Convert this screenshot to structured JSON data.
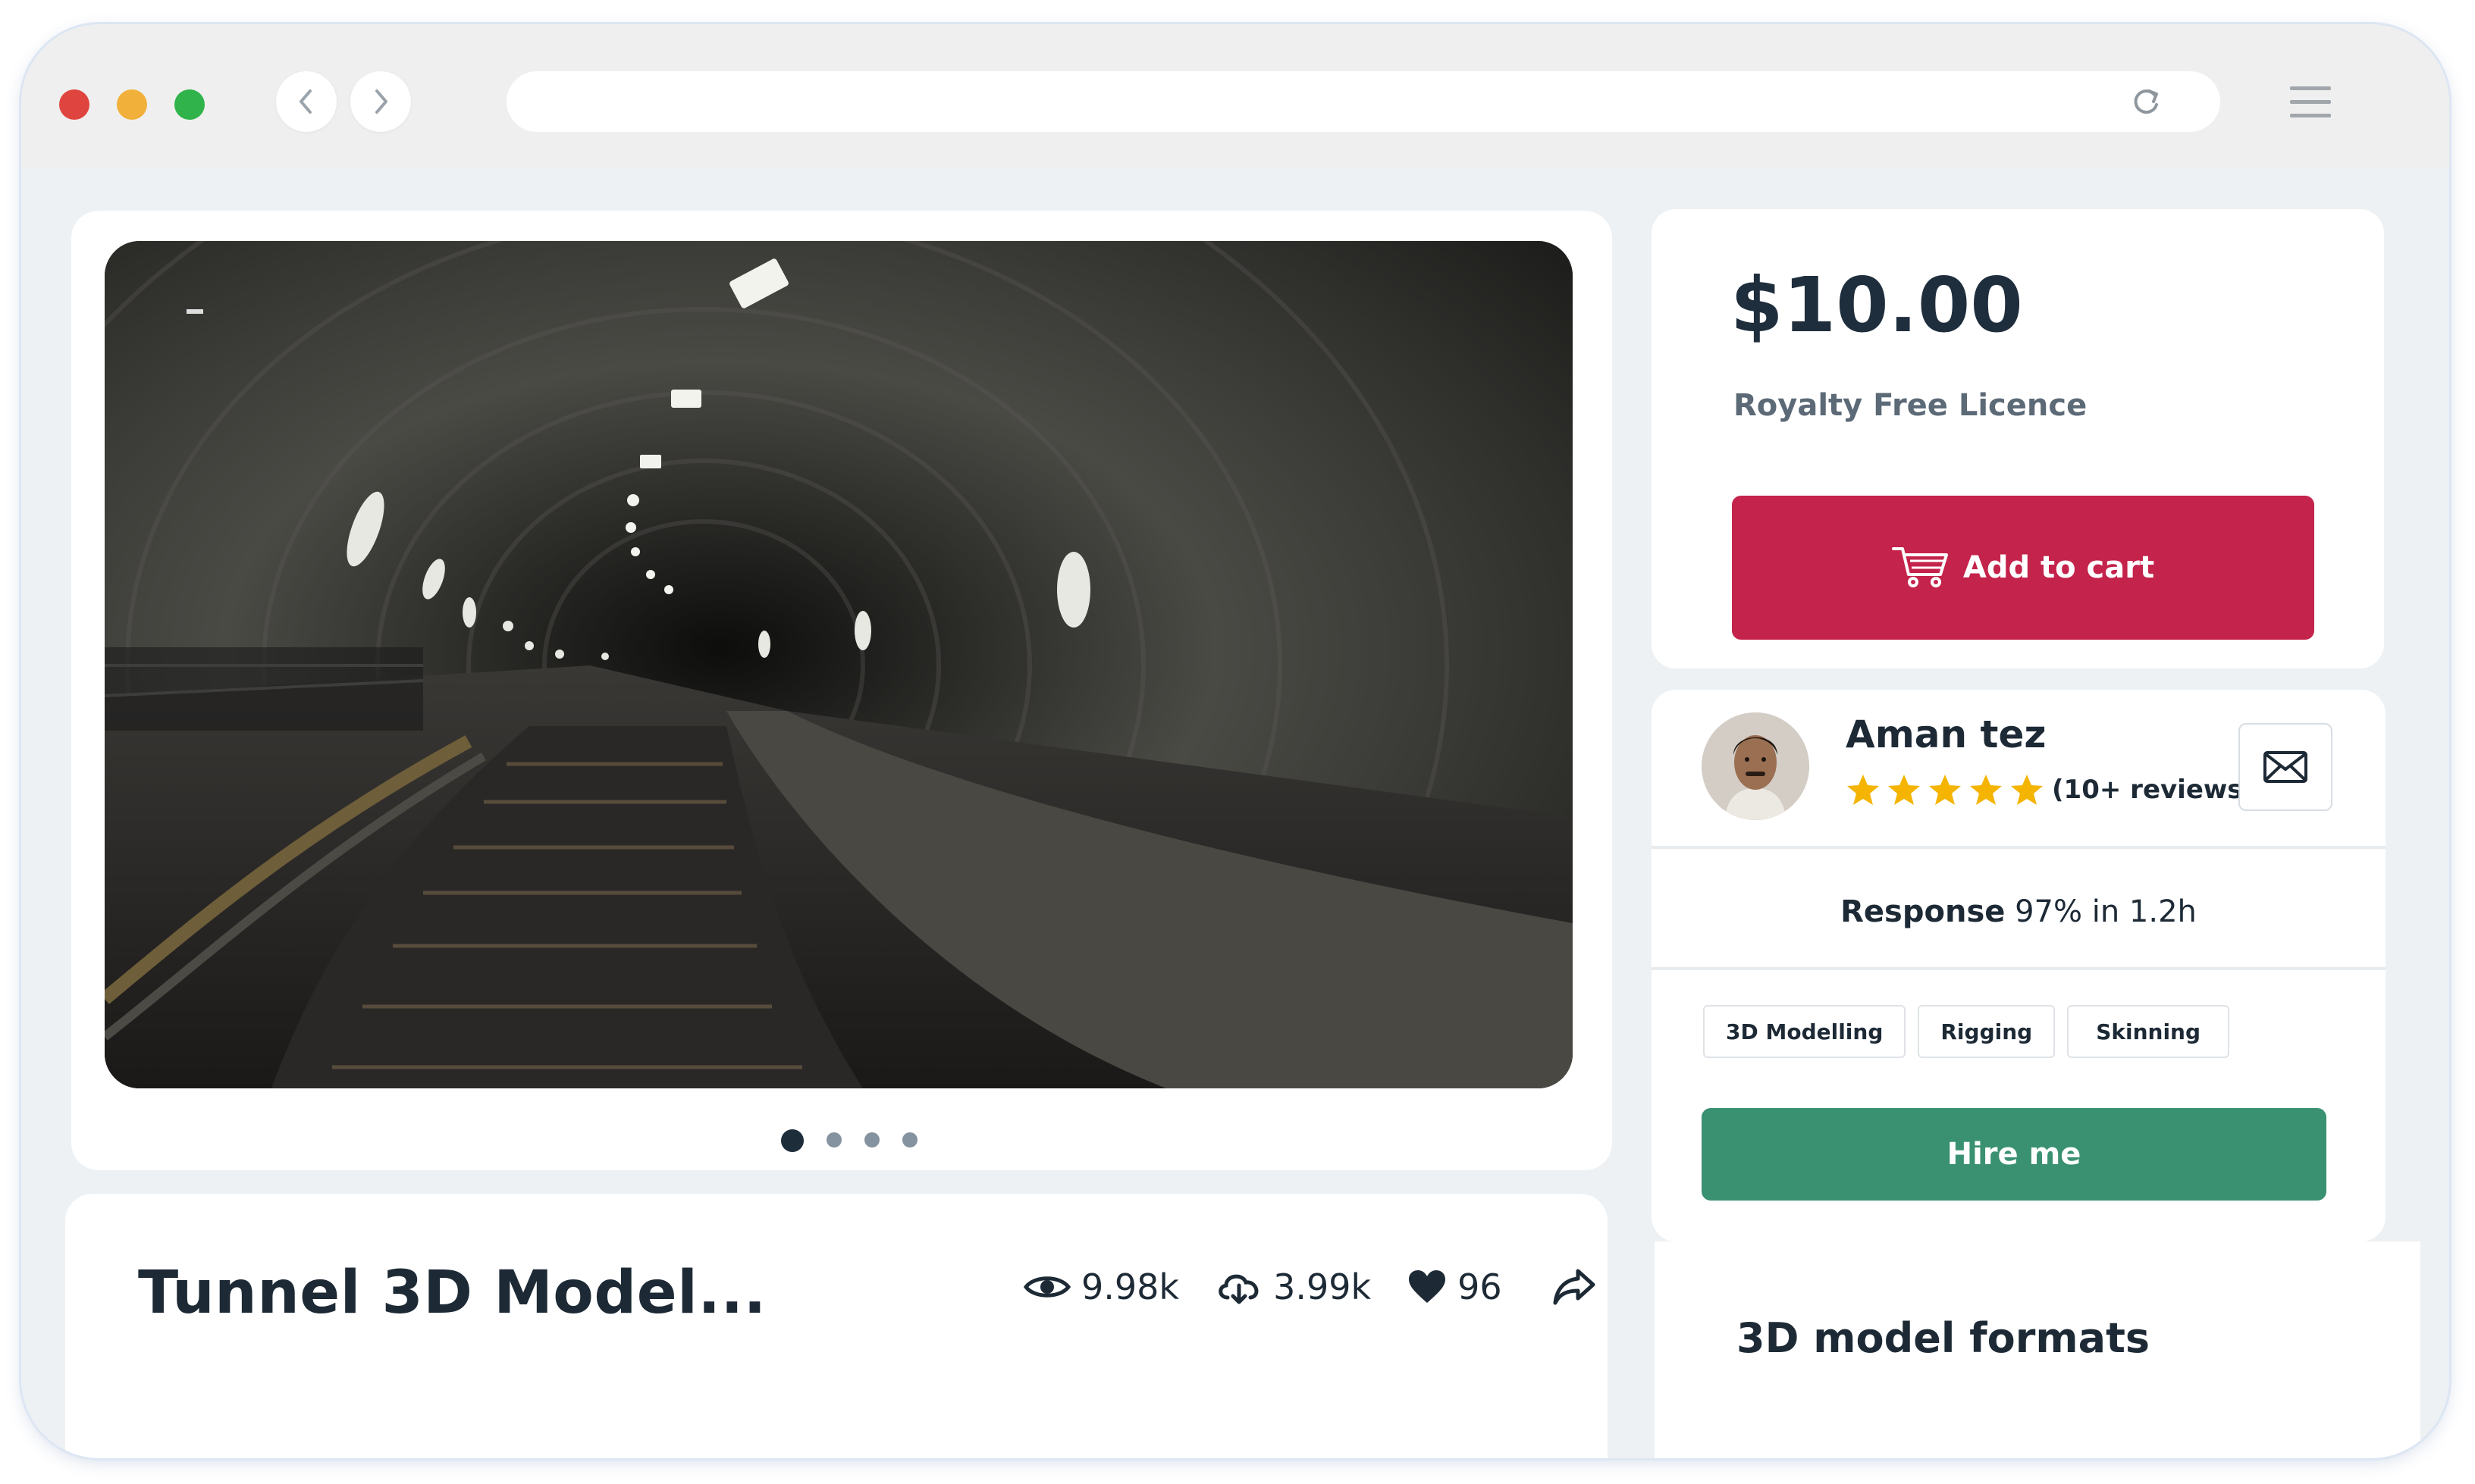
{
  "browser": {
    "traffic_lights": [
      "#e0443e",
      "#f0b03a",
      "#2fb34a"
    ],
    "url": ""
  },
  "product": {
    "title": "Tunnel 3D Model...",
    "views": "9.98k",
    "downloads": "3.99k",
    "likes": "96",
    "carousel": {
      "slides": 4,
      "active_index": 0
    }
  },
  "pricing": {
    "price": "$10.00",
    "licence": "Royalty Free Licence",
    "add_to_cart_label": "Add to cart",
    "accent": "#c4234b"
  },
  "seller": {
    "name": "Aman tez",
    "rating_stars": 5,
    "reviews": "(10+ reviews)",
    "response_label": "Response",
    "response_value": "97% in 1.2h",
    "skills": [
      "3D Modelling",
      "Rigging",
      "Skinning"
    ],
    "hire_label": "Hire me",
    "hire_color": "#3a9171"
  },
  "formats": {
    "title": "3D model formats"
  }
}
